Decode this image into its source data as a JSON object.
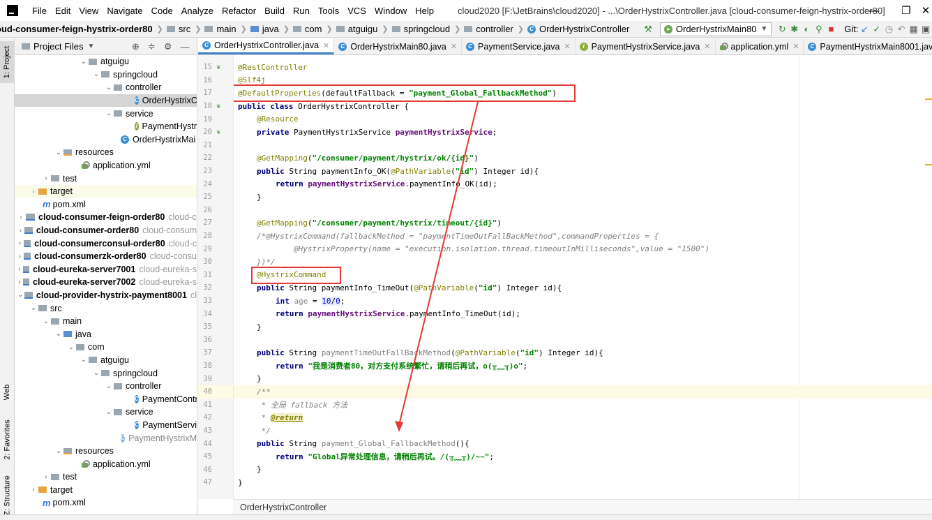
{
  "menu": {
    "items": [
      "File",
      "Edit",
      "View",
      "Navigate",
      "Code",
      "Analyze",
      "Refactor",
      "Build",
      "Run",
      "Tools",
      "VCS",
      "Window",
      "Help"
    ],
    "window_title": "cloud2020 [F:\\JetBrains\\cloud2020] - ...\\OrderHystrixController.java [cloud-consumer-feign-hystrix-order80]",
    "minimize": "—",
    "maximize": "❐",
    "close": "✕"
  },
  "navbar": {
    "crumbs": [
      "oud-consumer-feign-hystrix-order80",
      "src",
      "main",
      "java",
      "com",
      "atguigu",
      "springcloud",
      "controller",
      "OrderHystrixController"
    ],
    "run_config": "OrderHystrixMain80",
    "git_label": "Git:"
  },
  "left_stripe": {
    "project": "1: Project",
    "web": "Web",
    "favorites": "2: Favorites",
    "structure": "Z: Structure"
  },
  "project_panel": {
    "header": "Project Files",
    "rows": [
      {
        "label": "atguigu",
        "extra": ""
      },
      {
        "label": "springcloud",
        "extra": ""
      },
      {
        "label": "controller",
        "extra": ""
      },
      {
        "label": "OrderHystrixC",
        "extra": ""
      },
      {
        "label": "service",
        "extra": ""
      },
      {
        "label": "PaymentHystr",
        "extra": ""
      },
      {
        "label": "OrderHystrixMai",
        "extra": ""
      },
      {
        "label": "resources",
        "extra": ""
      },
      {
        "label": "application.yml",
        "extra": ""
      },
      {
        "label": "test",
        "extra": ""
      },
      {
        "label": "target",
        "extra": ""
      },
      {
        "label": "pom.xml",
        "extra": ""
      },
      {
        "label": "cloud-consumer-feign-order80",
        "extra": "cloud-c"
      },
      {
        "label": "cloud-consumer-order80",
        "extra": "cloud-consum"
      },
      {
        "label": "cloud-consumerconsul-order80",
        "extra": "cloud-c"
      },
      {
        "label": "cloud-consumerzk-order80",
        "extra": "cloud-consu"
      },
      {
        "label": "cloud-eureka-server7001",
        "extra": "cloud-eureka-s"
      },
      {
        "label": "cloud-eureka-server7002",
        "extra": "cloud-eureka-s"
      },
      {
        "label": "cloud-provider-hystrix-payment8001",
        "extra": "cl"
      },
      {
        "label": "src",
        "extra": ""
      },
      {
        "label": "main",
        "extra": ""
      },
      {
        "label": "java",
        "extra": ""
      },
      {
        "label": "com",
        "extra": ""
      },
      {
        "label": "atguigu",
        "extra": ""
      },
      {
        "label": "springcloud",
        "extra": ""
      },
      {
        "label": "controller",
        "extra": ""
      },
      {
        "label": "PaymentContr",
        "extra": ""
      },
      {
        "label": "service",
        "extra": ""
      },
      {
        "label": "PaymentServi",
        "extra": ""
      },
      {
        "label": "PaymentHystrixM",
        "extra": ""
      },
      {
        "label": "resources",
        "extra": ""
      },
      {
        "label": "application.yml",
        "extra": ""
      },
      {
        "label": "test",
        "extra": ""
      },
      {
        "label": "target",
        "extra": ""
      },
      {
        "label": "pom.xml",
        "extra": ""
      }
    ]
  },
  "editor": {
    "tabs": [
      {
        "label": "OrderHystrixController.java"
      },
      {
        "label": "OrderHystrixMain80.java"
      },
      {
        "label": "PaymentService.java"
      },
      {
        "label": "PaymentHystrixService.java"
      },
      {
        "label": "application.yml"
      },
      {
        "label": "PaymentHystrixMain8001.jav"
      }
    ],
    "tab_overflow": "≡₂",
    "line_numbers": [
      "15",
      "16",
      "17",
      "18",
      "19",
      "20",
      "21",
      "22",
      "23",
      "24",
      "25",
      "26",
      "27",
      "28",
      "29",
      "30",
      "31",
      "32",
      "33",
      "34",
      "35",
      "36",
      "37",
      "38",
      "39",
      "40",
      "41",
      "42",
      "43",
      "44",
      "45",
      "46",
      "47"
    ],
    "code": {
      "l15": "@RestController",
      "l16": "@Slf4j",
      "l17_ann": "@DefaultProperties",
      "l17_mid": "(defaultFallback = ",
      "l17_str": "\"payment_Global_FallbackMethod\"",
      "l17_end": ")",
      "l18_kw": "public class ",
      "l18_rest": "OrderHystrixController {",
      "l19": "@Resource",
      "l20_kw": "private ",
      "l20_type": "PaymentHystrixService ",
      "l20_fld": "paymentHystrixService",
      "l20_end": ";",
      "l22_ann": "@GetMapping",
      "l22_p1": "(",
      "l22_str": "\"/consumer/payment/hystrix/ok/{id}\"",
      "l22_p2": ")",
      "l23_kw": "public ",
      "l23_a": "String paymentInfo_OK(",
      "l23_ann": "@PathVariable",
      "l23_p": "(",
      "l23_str": "\"id\"",
      "l23_b": ") Integer id){",
      "l24_kw": "return ",
      "l24_fld": "paymentHystrixService",
      "l24_rest": ".paymentInfo_OK(id);",
      "l25": "}",
      "l27_ann": "@GetMapping",
      "l27_p1": "(",
      "l27_str": "\"/consumer/payment/hystrix/timeout/{id}\"",
      "l27_p2": ")",
      "l28": "/*@HystrixCommand(fallbackMethod = \"paymentTimeOutFallBackMethod\",commandProperties = {",
      "l29": "@HystrixProperty(name = \"execution.isolation.thread.timeoutInMilliseconds\",value = \"1500\")",
      "l30": "})*/",
      "l31": "@HystrixCommand",
      "l32_kw": "public ",
      "l32_a": "String paymentInfo_TimeOut(",
      "l32_ann": "@PathVariable",
      "l32_p": "(",
      "l32_str": "\"id\"",
      "l32_b": ") Integer id){",
      "l33_kw": "int ",
      "l33_var": "age",
      "l33_eq": " = ",
      "l33_n1": "10",
      "l33_sl": "/",
      "l33_n2": "0",
      "l33_end": ";",
      "l34_kw": "return ",
      "l34_fld": "paymentHystrixService",
      "l34_rest": ".paymentInfo_TimeOut(id);",
      "l35": "}",
      "l37_kw": "public ",
      "l37_a": "String ",
      "l37_unused": "paymentTimeOutFallBackMethod",
      "l37_p": "(",
      "l37_ann": "@PathVariable",
      "l37_p2": "(",
      "l37_str": "\"id\"",
      "l37_b": ") Integer id){",
      "l38_kw": "return ",
      "l38_str": "\"我是消费者80，对方支付系统繁忙，请稍后再试，o(╥﹏╥)o\"",
      "l38_end": ";",
      "l39": "}",
      "l40": "/**",
      "l41": " * 全局 fallback 方法",
      "l42_a": " * ",
      "l42_tag": "@return",
      "l43": " */",
      "l44_kw": "public ",
      "l44_a": "String ",
      "l44_unused": "payment_Global_FallbackMethod",
      "l44_b": "(){",
      "l45_kw": "return ",
      "l45_str": "\"Global异常处理信息，请稍后再试。/(╥﹏╥)/~~\"",
      "l45_end": ";",
      "l46": "}",
      "l47": "}"
    },
    "bottom_breadcrumb": "OrderHystrixController"
  },
  "colors": {
    "annotation_box": "#e53935",
    "arrow": "#e53935",
    "accent_tab": "#4083c9"
  }
}
